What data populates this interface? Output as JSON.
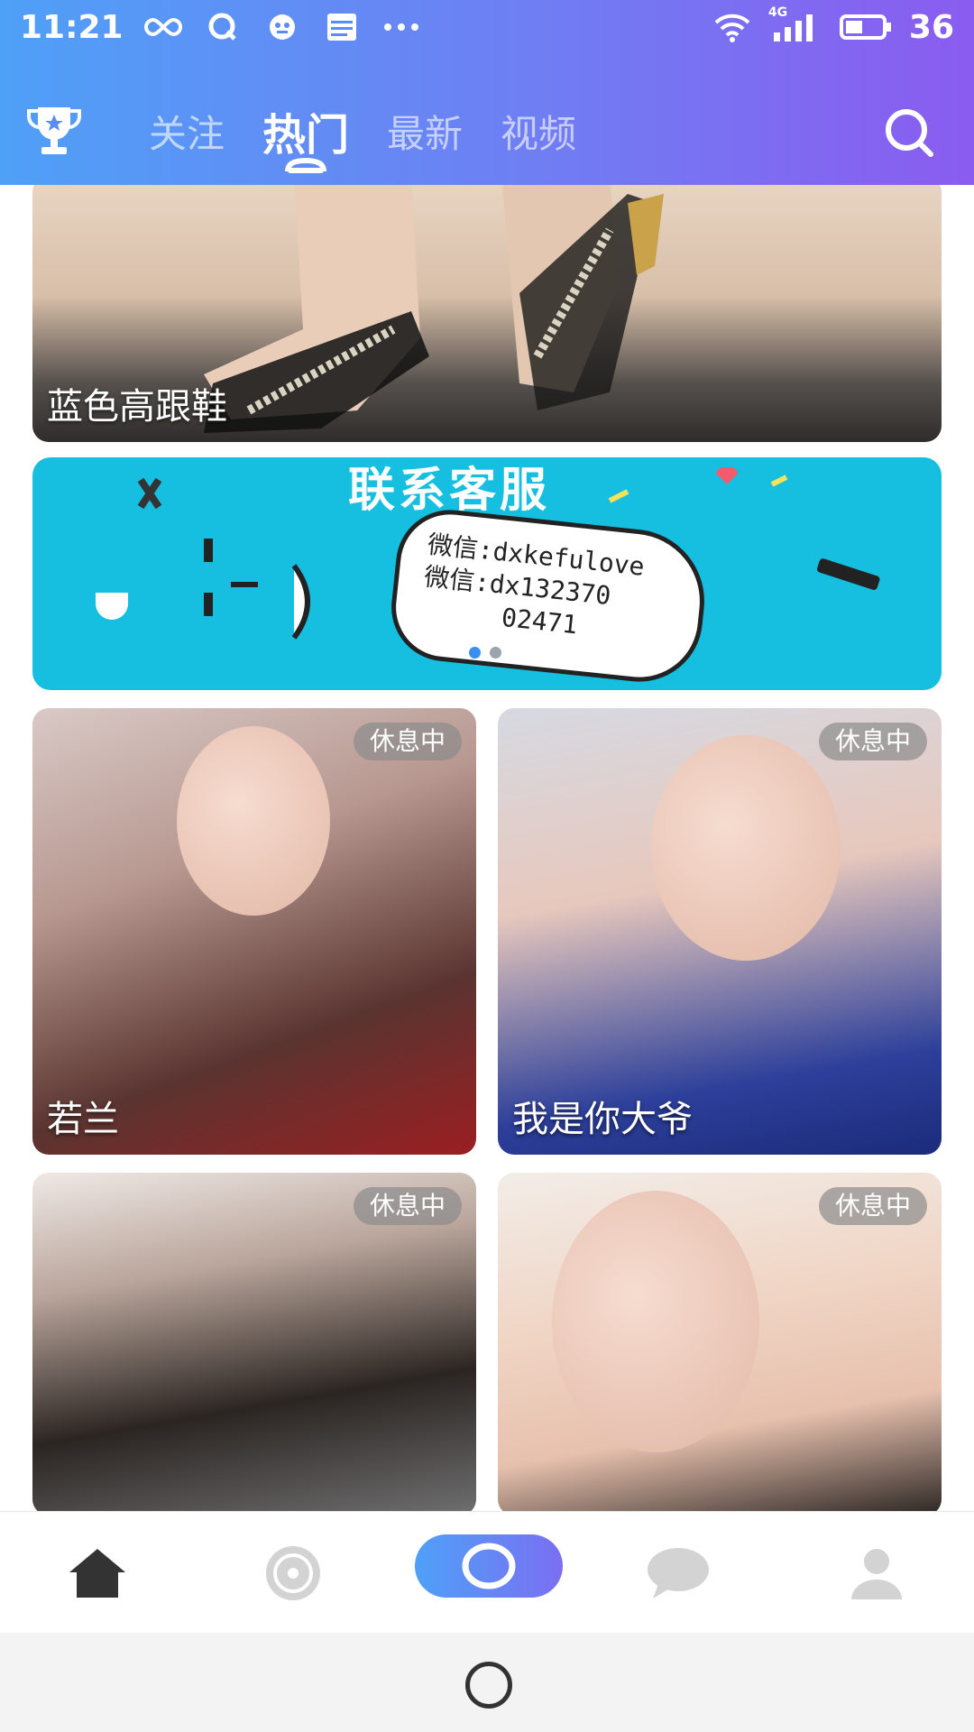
{
  "status_bar": {
    "time": "11:21",
    "icons": [
      "infinity-icon",
      "q-icon",
      "app-icon",
      "news-icon",
      "more-icon"
    ],
    "network": "4G",
    "battery": "36"
  },
  "header": {
    "tabs": [
      {
        "label": "关注"
      },
      {
        "label": "热门"
      },
      {
        "label": "最新"
      },
      {
        "label": "视频"
      }
    ],
    "active_tab": "热门"
  },
  "feed": {
    "top_card_title": "蓝色高跟鞋",
    "banner": {
      "title": "联系客服",
      "line1": "微信:dxkefulove",
      "line2": "微信:dx132370",
      "line3": "02471"
    },
    "anchors": [
      {
        "name": "若兰",
        "status": "休息中"
      },
      {
        "name": "我是你大爷",
        "status": "休息中"
      },
      {
        "name": "",
        "status": "休息中"
      },
      {
        "name": "",
        "status": "休息中"
      }
    ]
  },
  "colors": {
    "header_start": "#4fa0f7",
    "header_end": "#8a5cf0",
    "banner_bg": "#16bfe0",
    "accent": "#3a8ef0"
  }
}
